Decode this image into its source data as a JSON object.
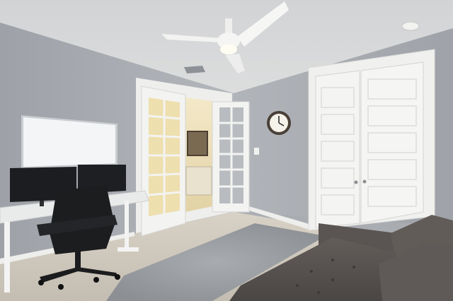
{
  "scene": {
    "kind": "photograph",
    "subject": "home-office-room",
    "colors": {
      "wall": "#a9adb3",
      "wall_shadow": "#8f949b",
      "ceiling": "#d9dadb",
      "trim": "#f1f1ef",
      "floor": "#cfc8bd",
      "rug": "#9ea2a6",
      "sofa": "#5b5654",
      "monitor": "#1b1d20",
      "whiteboard": "#f4f5f6",
      "desk_top": "#e9eaea",
      "chair": "#1c1d1f",
      "warm_light": "#efe1b8",
      "clock_face": "#f5f2ea"
    }
  }
}
